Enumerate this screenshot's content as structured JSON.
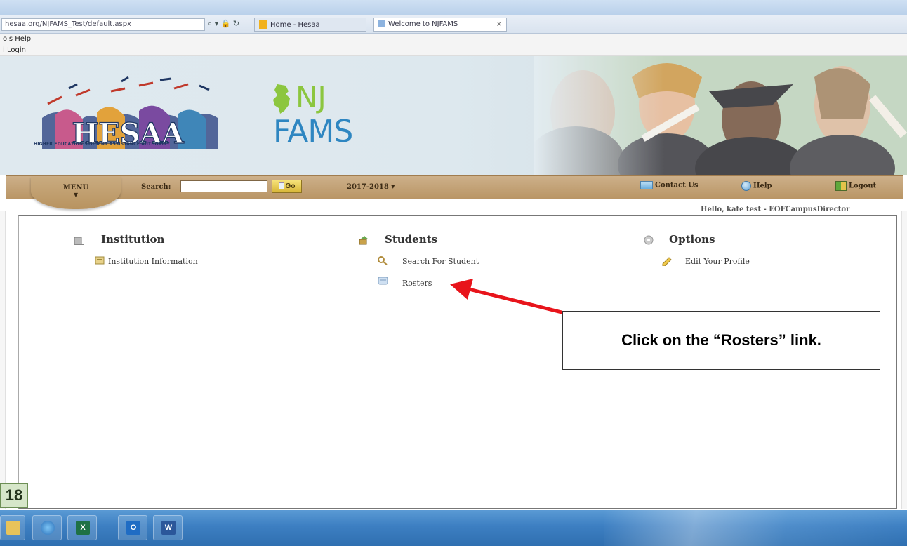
{
  "browser": {
    "address": "hesaa.org/NJFAMS_Test/default.aspx",
    "tabs": [
      {
        "label": "Home - Hesaa"
      },
      {
        "label": "Welcome to NJFAMS"
      }
    ],
    "tab_close": "×",
    "menu_items": "ols  Help",
    "favorites": "i Login"
  },
  "banner": {
    "hesaa_logo_text": "HESAA",
    "hesaa_tagline": "HIGHER EDUCATION STUDENT ASSISTANCE AUTHORITY",
    "njfams_nj": "NJ",
    "njfams_fams": "FAMS"
  },
  "nav": {
    "menu_label": "MENU",
    "menu_caret": "▼",
    "search_label": "Search:",
    "search_value": "",
    "go_label": "Go",
    "year_selector": "2017-2018 ▾",
    "contact_label": "Contact Us",
    "help_label": "Help",
    "logout_label": "Logout",
    "greeting": "Hello, kate test - EOFCampusDirector"
  },
  "sections": {
    "institution": {
      "title": "Institution",
      "links": [
        "Institution Information"
      ]
    },
    "students": {
      "title": "Students",
      "links": [
        "Search For Student",
        "Rosters"
      ]
    },
    "options": {
      "title": "Options",
      "links": [
        "Edit Your Profile"
      ]
    }
  },
  "annotation": {
    "text": "Click on the “Rosters” link.",
    "color": "#e8141b"
  },
  "page_badge": "18",
  "taskbar": {
    "apps": [
      "windows-explorer",
      "internet-explorer",
      "excel",
      "outlook",
      "word"
    ],
    "excel_glyph": "X",
    "outlook_glyph": "O",
    "word_glyph": "W"
  }
}
